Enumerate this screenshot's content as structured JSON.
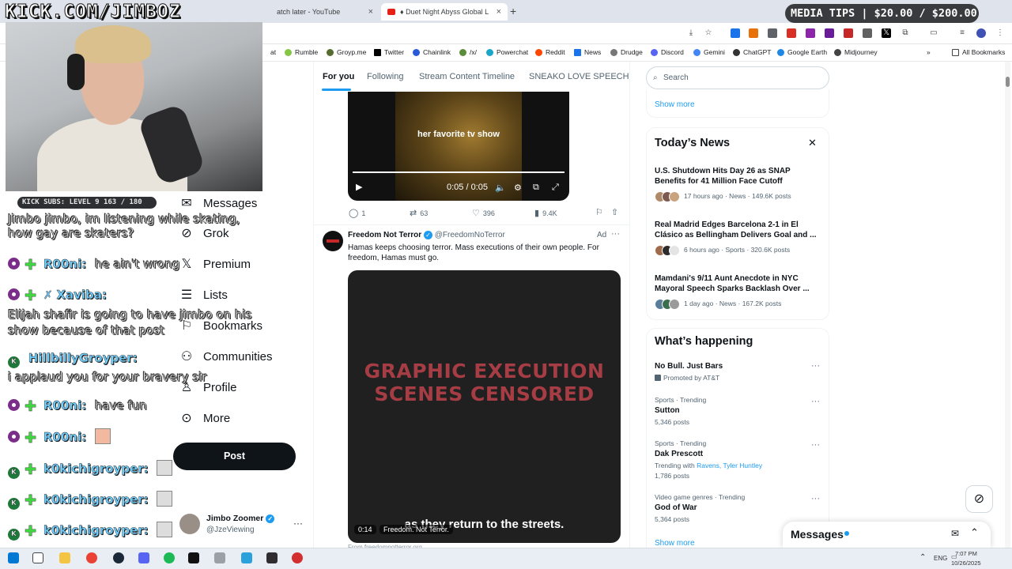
{
  "browser": {
    "tabs": [
      {
        "label": "atch later - YouTube"
      },
      {
        "label": "♦ Duet Night Abyss Global La"
      }
    ],
    "new_tab": "+",
    "bookmarks": [
      "Rumble",
      "Groyp.me",
      "Twitter",
      "Chainlink",
      "/x/",
      "Powerchat",
      "Reddit",
      "News",
      "Drudge",
      "Discord",
      "Gemini",
      "ChatGPT",
      "Google Earth",
      "Midjourney"
    ],
    "bookmark_prefix": "at",
    "all_bookmarks": "All Bookmarks"
  },
  "stream": {
    "overlay_url": "KICK.COM/JIMBOZ",
    "kick_subs": "KICK SUBS: LEVEL 9 163 / 180",
    "media_tips": "MEDIA TIPS | $20.00 / $200.00",
    "chat": [
      {
        "user": "",
        "msg": "Jimbo jimbo, im listening while skating, how gay are skaters?"
      },
      {
        "user": "R00ni:",
        "msg": "he ain't wrong"
      },
      {
        "user": "Xaviba:",
        "msg": "Elijah shafir is going to have jimbo on his show because of that post"
      },
      {
        "user": "HillbillyGroyper:",
        "msg": "i applaud you for your bravery sir"
      },
      {
        "user": "R00ni:",
        "msg": "have fun"
      },
      {
        "user": "R00ni:",
        "msg": ""
      },
      {
        "user": "k0kichigroyper:",
        "msg": ""
      },
      {
        "user": "k0kichigroyper:",
        "msg": ""
      },
      {
        "user": "k0kichigroyper:",
        "msg": ""
      }
    ]
  },
  "nav": {
    "items": [
      "Messages",
      "Grok",
      "Premium",
      "Lists",
      "Bookmarks",
      "Communities",
      "Profile",
      "More"
    ],
    "post": "Post",
    "account_name": "Jimbo Zoomer",
    "account_handle": "@JzeViewing"
  },
  "timeline": {
    "tabs": [
      "For you",
      "Following",
      "Stream Content Timeline",
      "SNEAKO LOVE SPEECH"
    ],
    "video1": {
      "caption": "her favorite tv show",
      "time": "0:05 / 0:05",
      "progress": 1.0
    },
    "actions": {
      "replies": "1",
      "reposts": "63",
      "likes": "396",
      "views": "9.4K"
    },
    "tweet": {
      "name": "Freedom Not Terror",
      "handle": "@FreedomNoTerror",
      "ad": "Ad",
      "text": "Hamas keeps choosing terror. Mass executions of their own people. For freedom, Hamas must go.",
      "video_text": "GRAPHIC EXECUTION SCENES CENSORED",
      "subtitle": "as they return to the streets.",
      "time": "0:14",
      "watermark": "Freedom. Not Terror.",
      "from": "From freedomnotterror.org"
    }
  },
  "sidebar": {
    "search_placeholder": "Search",
    "show_more_top": "Show more",
    "news_title": "Today’s News",
    "news": [
      {
        "title": "U.S. Shutdown Hits Day 26 as SNAP Benefits for 41 Million Face Cutoff",
        "meta": "17 hours ago · News · 149.6K posts"
      },
      {
        "title": "Real Madrid Edges Barcelona 2-1 in El Clásico as Bellingham Delivers Goal and ...",
        "meta": "6 hours ago · Sports · 320.6K posts"
      },
      {
        "title": "Mamdani's 9/11 Aunt Anecdote in NYC Mayoral Speech Sparks Backlash Over ...",
        "meta": "1 day ago · News · 167.2K posts"
      }
    ],
    "happening_title": "What’s happening",
    "trends": [
      {
        "category": "",
        "name": "No Bull. Just Bars",
        "sub": "Promoted by AT&T"
      },
      {
        "category": "Sports · Trending",
        "name": "Sutton",
        "sub": "5,346 posts"
      },
      {
        "category": "Sports · Trending",
        "name": "Dak Prescott",
        "with": "Trending with",
        "links": "Ravens,  Tyler Huntley",
        "sub": "1,786 posts"
      },
      {
        "category": "Video game genres · Trending",
        "name": "God of War",
        "sub": "5,364 posts"
      }
    ],
    "show_more_bottom": "Show more",
    "messages": "Messages"
  },
  "taskbar": {
    "lang": "ENG",
    "time": "7:07 PM",
    "date": "10/26/2025"
  },
  "colors": {
    "accent": "#1d9bf0",
    "chat_user": "#6fd0ff",
    "censor_text": "#a63d45"
  }
}
